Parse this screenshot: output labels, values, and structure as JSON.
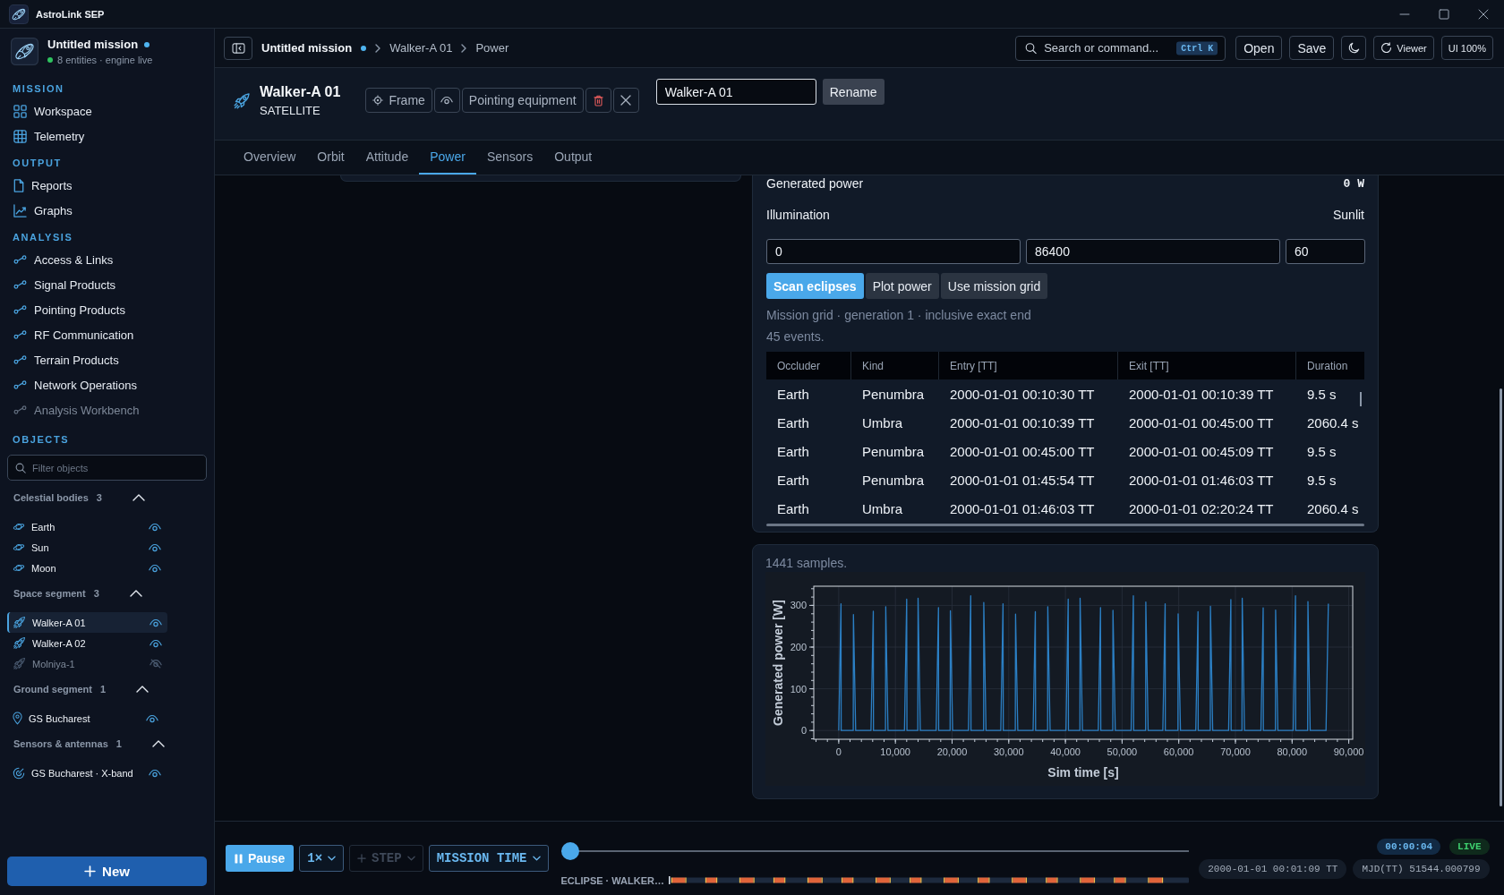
{
  "window": {
    "title": "AstroLink SEP"
  },
  "sidebar": {
    "mission": {
      "name": "Untitled mission",
      "modified": true,
      "online": true,
      "status": "8 entities · engine live"
    },
    "sections": [
      {
        "title": "MISSION",
        "items": [
          {
            "label": "Workspace",
            "kind": "workspace",
            "disabled": false
          },
          {
            "label": "Telemetry",
            "kind": "telemetry",
            "disabled": false
          }
        ]
      },
      {
        "title": "OUTPUT",
        "items": [
          {
            "label": "Reports",
            "kind": "reports",
            "disabled": false
          },
          {
            "label": "Graphs",
            "kind": "graphs",
            "disabled": false
          }
        ]
      },
      {
        "title": "ANALYSIS",
        "items": [
          {
            "label": "Access & Links",
            "kind": "analysis",
            "disabled": false
          },
          {
            "label": "Signal Products",
            "kind": "analysis",
            "disabled": false
          },
          {
            "label": "Pointing Products",
            "kind": "analysis",
            "disabled": false
          },
          {
            "label": "RF Communication",
            "kind": "analysis",
            "disabled": false
          },
          {
            "label": "Terrain Products",
            "kind": "analysis",
            "disabled": false
          },
          {
            "label": "Network Operations",
            "kind": "analysis",
            "disabled": false
          },
          {
            "label": "Analysis Workbench",
            "kind": "analysis",
            "disabled": true
          }
        ]
      }
    ],
    "objects": {
      "title": "OBJECTS",
      "filter": {
        "placeholder": "Filter objects"
      },
      "groups": [
        {
          "name": "Celestial bodies",
          "count": "3",
          "expanded": true,
          "items": [
            {
              "name": "Earth",
              "kind": "body",
              "visible": true,
              "selected": false
            },
            {
              "name": "Sun",
              "kind": "body",
              "visible": true,
              "selected": false
            },
            {
              "name": "Moon",
              "kind": "body",
              "visible": true,
              "selected": false
            }
          ]
        },
        {
          "name": "Space segment",
          "count": "3",
          "expanded": true,
          "items": [
            {
              "name": "Walker-A 01",
              "kind": "satellite",
              "visible": true,
              "selected": true
            },
            {
              "name": "Walker-A 02",
              "kind": "satellite",
              "visible": true,
              "selected": false
            },
            {
              "name": "Molniya-1",
              "kind": "satellite",
              "visible": false,
              "selected": false
            }
          ]
        },
        {
          "name": "Ground segment",
          "count": "1",
          "expanded": true,
          "items": [
            {
              "name": "GS Bucharest",
              "kind": "station",
              "visible": true,
              "selected": false
            }
          ]
        },
        {
          "name": "Sensors & antennas",
          "count": "1",
          "expanded": true,
          "items": [
            {
              "name": "GS Bucharest · X-band",
              "kind": "sensor",
              "visible": true,
              "selected": false
            }
          ]
        }
      ]
    },
    "new_button": {
      "label": "New"
    }
  },
  "topbar": {
    "breadcrumb": {
      "mission": "Untitled mission",
      "modified": true,
      "path": [
        "Walker-A 01",
        "Power"
      ]
    },
    "search": {
      "placeholder": "Search or command...",
      "shortcut": "Ctrl K"
    },
    "actions": [
      {
        "kind": "open",
        "label": "Open"
      },
      {
        "kind": "save",
        "label": "Save"
      },
      {
        "kind": "theme"
      },
      {
        "kind": "viewer",
        "label": "Viewer"
      },
      {
        "kind": "zoom",
        "label": "UI 100%"
      }
    ]
  },
  "entity": {
    "name": "Walker-A 01",
    "type": "SATELLITE",
    "actions": [
      {
        "kind": "frame",
        "label": "Frame"
      },
      {
        "kind": "visibility"
      },
      {
        "kind": "pointing",
        "label": "Pointing equipment"
      },
      {
        "kind": "delete"
      },
      {
        "kind": "close"
      }
    ],
    "rename": {
      "value": "Walker-A 01",
      "label": "Rename"
    }
  },
  "tabs": [
    {
      "label": "Overview",
      "selected": false
    },
    {
      "label": "Orbit",
      "selected": false
    },
    {
      "label": "Attitude",
      "selected": false
    },
    {
      "label": "Power",
      "selected": true
    },
    {
      "label": "Sensors",
      "selected": false
    },
    {
      "label": "Output",
      "selected": false
    }
  ],
  "power_panel": {
    "generated_power": {
      "label": "Generated power",
      "value": "0 W"
    },
    "illumination": {
      "label": "Illumination",
      "value": "Sunlit"
    },
    "inputs": [
      {
        "value": "0"
      },
      {
        "value": "86400"
      },
      {
        "value": "60"
      }
    ],
    "buttons": [
      {
        "label": "Scan eclipses",
        "primary": true
      },
      {
        "label": "Plot power",
        "primary": false
      },
      {
        "label": "Use mission grid",
        "primary": false
      }
    ],
    "grid_info": "Mission grid · generation 1 · inclusive exact end",
    "event_count": "45 events.",
    "table": {
      "columns": [
        "Occluder",
        "Kind",
        "Entry [TT]",
        "Exit [TT]",
        "Duration"
      ],
      "rows": [
        [
          "Earth",
          "Penumbra",
          "2000-01-01 00:10:30 TT",
          "2000-01-01 00:10:39 TT",
          "9.5 s"
        ],
        [
          "Earth",
          "Umbra",
          "2000-01-01 00:10:39 TT",
          "2000-01-01 00:45:00 TT",
          "2060.4 s"
        ],
        [
          "Earth",
          "Penumbra",
          "2000-01-01 00:45:00 TT",
          "2000-01-01 00:45:09 TT",
          "9.5 s"
        ],
        [
          "Earth",
          "Penumbra",
          "2000-01-01 01:45:54 TT",
          "2000-01-01 01:46:03 TT",
          "9.5 s"
        ],
        [
          "Earth",
          "Umbra",
          "2000-01-01 01:46:03 TT",
          "2000-01-01 02:20:24 TT",
          "2060.4 s"
        ]
      ]
    }
  },
  "chart_panel": {
    "samples": "1441 samples.",
    "chart_data": {
      "type": "line",
      "xlabel": "Sim time [s]",
      "ylabel": "Generated power [W]",
      "x": [
        0,
        400,
        440,
        2560,
        2600,
        3000,
        5700,
        6100,
        6140,
        8260,
        8300,
        8700,
        11600,
        12000,
        12040,
        13960,
        14000,
        14400,
        17200,
        17600,
        17640,
        19660,
        19700,
        20100,
        22900,
        23300,
        23340,
        25560,
        25600,
        26000,
        28600,
        29000,
        29040,
        31160,
        31200,
        31600,
        34300,
        34700,
        34740,
        36860,
        36900,
        37300,
        40100,
        40500,
        40540,
        42560,
        42600,
        43000,
        45800,
        46200,
        46240,
        48360,
        48400,
        48800,
        51600,
        52000,
        52040,
        54160,
        54200,
        54600,
        57200,
        57600,
        57640,
        59860,
        59900,
        60300,
        63000,
        63400,
        63440,
        65560,
        65600,
        66000,
        68800,
        69200,
        69240,
        71160,
        71200,
        71600,
        74500,
        74900,
        74940,
        77060,
        77100,
        77500,
        80200,
        80600,
        80640,
        82760,
        82800,
        83200,
        86000,
        86400
      ],
      "values": [
        0,
        304,
        0,
        0,
        278,
        0,
        0,
        286,
        0,
        0,
        297,
        0,
        0,
        315,
        0,
        0,
        317,
        0,
        0,
        295,
        0,
        0,
        287,
        0,
        0,
        323,
        0,
        0,
        307,
        0,
        0,
        304,
        0,
        0,
        279,
        0,
        0,
        285,
        0,
        0,
        297,
        0,
        0,
        315,
        0,
        0,
        317,
        0,
        0,
        295,
        0,
        0,
        288,
        0,
        0,
        323,
        0,
        0,
        308,
        0,
        0,
        304,
        0,
        0,
        280,
        0,
        0,
        285,
        0,
        0,
        298,
        0,
        0,
        314,
        0,
        0,
        317,
        0,
        0,
        294,
        0,
        0,
        289,
        0,
        0,
        323,
        0,
        0,
        309,
        0,
        0,
        304
      ],
      "xlim": [
        -4400,
        90700
      ],
      "ylim": [
        -21,
        346
      ],
      "xticks": [
        0,
        {
          "value": 10000,
          "label": "10,000"
        },
        {
          "value": 20000,
          "label": "20,000"
        },
        {
          "value": 30000,
          "label": "30,000"
        },
        {
          "value": 40000,
          "label": "40,000"
        },
        {
          "value": 50000,
          "label": "50,000"
        },
        {
          "value": 60000,
          "label": "60,000"
        },
        {
          "value": 70000,
          "label": "70,000"
        },
        {
          "value": 80000,
          "label": "80,000"
        },
        {
          "value": 90000,
          "label": "90,000"
        }
      ],
      "yticks": [
        0,
        100,
        200,
        300
      ],
      "grid": true
    }
  },
  "playback": {
    "pause_label": "Pause",
    "speed": "1×",
    "step": {
      "label": "STEP",
      "disabled": true
    },
    "time_mode": "MISSION TIME",
    "timeline": {
      "level": 0
    },
    "track_label": "ECLIPSE · WALKER…",
    "elapsed": "00:00:04",
    "live": "LIVE",
    "epoch": "2000-01-01 00:01:09 TT",
    "mjd": "MJD(TT) 51544.000799"
  }
}
